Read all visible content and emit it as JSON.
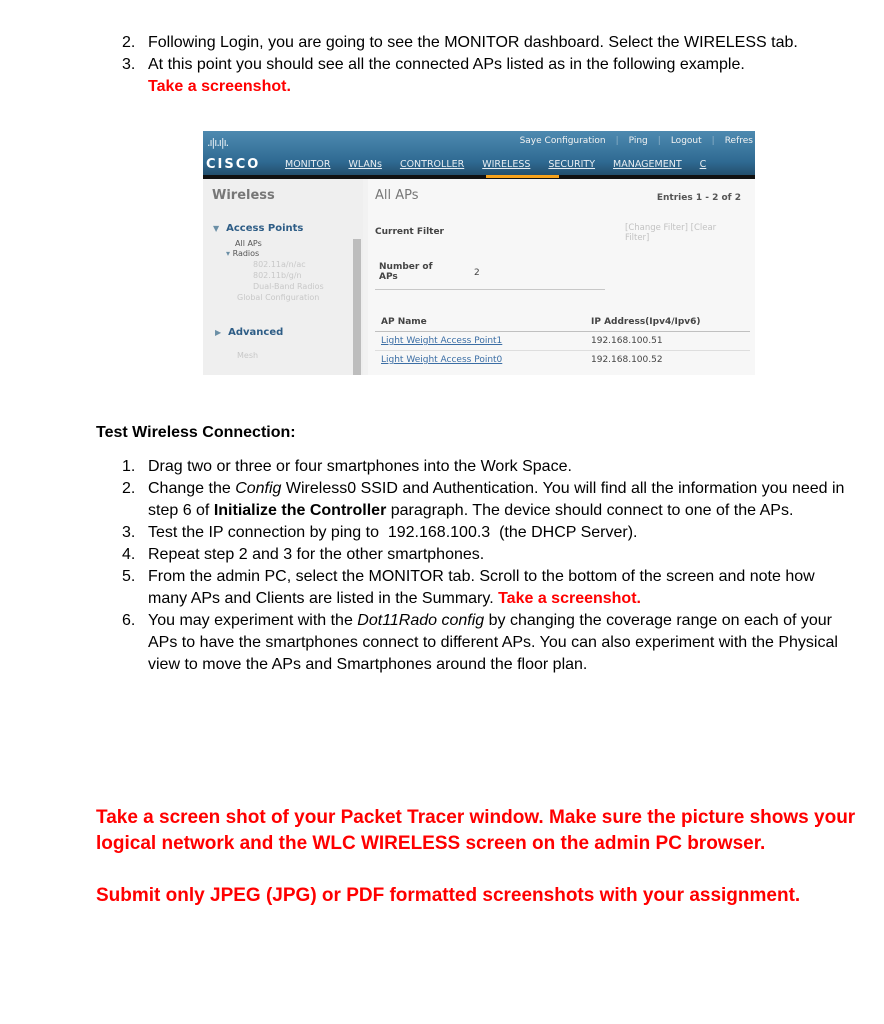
{
  "top_steps": [
    {
      "num": "2.",
      "text": "Following Login, you are going to see the MONITOR dashboard.  Select the WIRELESS tab."
    },
    {
      "num": "3.",
      "text": "At this point you should see all the connected APs listed as in the following example.",
      "highlight": "Take a screenshot."
    }
  ],
  "wlc": {
    "logo": "cisco",
    "logo_bars": ".ı|ı.ı|ı.",
    "top_links": [
      "Saye Configuration",
      "Ping",
      "Logout",
      "Refres"
    ],
    "nav": [
      "MONITOR",
      "WLANs",
      "CONTROLLER",
      "WIRELESS",
      "SECURITY",
      "MANAGEMENT",
      "C"
    ],
    "active_nav": "WIRELESS",
    "accent_color": "#f7a21b",
    "sidebar": {
      "title": "Wireless",
      "access_points": "Access Points",
      "all_aps": "All APs",
      "radios": "Radios",
      "radio_items": [
        "802.11a/n/ac",
        "802.11b/g/n",
        "Dual-Band Radios"
      ],
      "global_config": "Global Configuration",
      "advanced": "Advanced",
      "mesh": "Mesh"
    },
    "main": {
      "title": "All APs",
      "entries": "Entries 1 - 2 of 2",
      "current_filter_label": "Current Filter",
      "filter_links": "[Change Filter] [Clear Filter]",
      "num_aps_label": "Number of APs",
      "num_aps_value": "2",
      "columns": [
        "AP Name",
        "IP Address(Ipv4/Ipv6)"
      ],
      "rows": [
        {
          "name": "Light Weight Access Point1",
          "ip": "192.168.100.51"
        },
        {
          "name": "Light Weight Access Point0",
          "ip": "192.168.100.52"
        }
      ]
    }
  },
  "test_section": {
    "heading": "Test Wireless Connection:",
    "steps": [
      {
        "num": "1.",
        "text": "Drag two or three or four smartphones into the Work Space."
      },
      {
        "num": "2.",
        "pre": "Change the ",
        "ital": "Config",
        "mid": " Wireless0 SSID and Authentication.  You will find all the information you need in step 6 of ",
        "bold": "Initialize the Controller",
        "post": " paragraph.  The device should connect to one of the APs."
      },
      {
        "num": "3.",
        "text": "Test the IP connection by ping to  192.168.100.3  (the DHCP Server)."
      },
      {
        "num": "4.",
        "text": "Repeat step 2 and 3 for the other smartphones."
      },
      {
        "num": "5.",
        "text": "From the admin PC, select the MONITOR tab.  Scroll to the bottom of the screen and note how many APs and Clients are listed in the Summary.",
        "highlight": "Take a screenshot."
      },
      {
        "num": "6.",
        "pre": "You may experiment with the ",
        "ital": "Dot11Rado config",
        "post": " by changing the coverage range on each of your APs to have the smartphones connect to different APs.   You can also experiment with the Physical view to move the APs and Smartphones around the floor plan."
      }
    ]
  },
  "final_notes": [
    "Take a screen shot of your Packet Tracer window.  Make sure the picture shows your logical network and the WLC WIRELESS screen on the admin PC browser.",
    "Submit only JPEG (JPG) or PDF formatted screenshots with your assignment."
  ]
}
